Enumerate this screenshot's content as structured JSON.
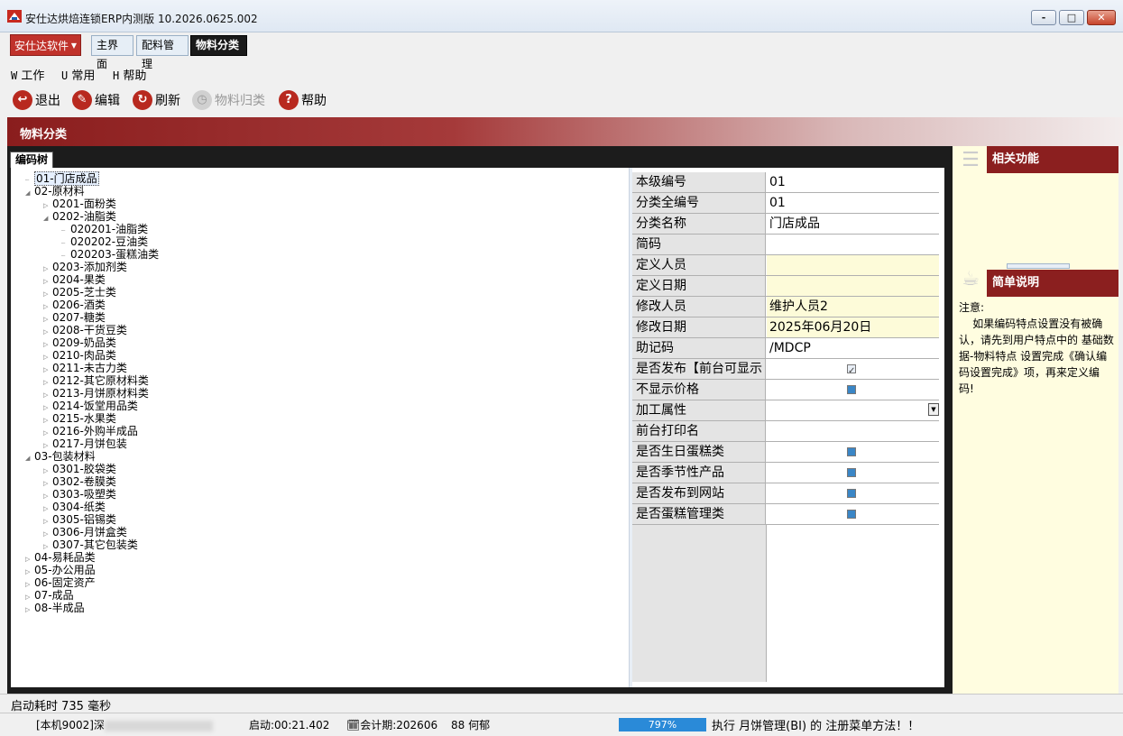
{
  "window": {
    "title": "安仕达烘焙连锁ERP内测版   10.2026.0625.002",
    "minimize": "-",
    "maximize": "□",
    "close": "✕"
  },
  "tabs": {
    "brand": "安仕达软件",
    "items": [
      "主界面",
      "配料管理",
      "物料分类"
    ]
  },
  "menu": [
    {
      "key": "W",
      "label": "工作"
    },
    {
      "key": "U",
      "label": "常用"
    },
    {
      "key": "H",
      "label": "帮助"
    }
  ],
  "toolbar": {
    "exit": "退出",
    "edit": "编辑",
    "refresh": "刷新",
    "categorize": "物料归类",
    "help": "帮助"
  },
  "page": {
    "title": "物料分类",
    "tree_tab": "编码树"
  },
  "tree": [
    {
      "label": "01-门店成品",
      "level": 0,
      "expander": "",
      "selected": true
    },
    {
      "label": "02-原材料",
      "level": 0,
      "expander": "◢"
    },
    {
      "label": "0201-面粉类",
      "level": 1,
      "expander": "▷"
    },
    {
      "label": "0202-油脂类",
      "level": 1,
      "expander": "◢"
    },
    {
      "label": "020201-油脂类",
      "level": 2,
      "expander": ""
    },
    {
      "label": "020202-豆油类",
      "level": 2,
      "expander": ""
    },
    {
      "label": "020203-蛋糕油类",
      "level": 2,
      "expander": ""
    },
    {
      "label": "0203-添加剂类",
      "level": 1,
      "expander": "▷"
    },
    {
      "label": "0204-果类",
      "level": 1,
      "expander": "▷"
    },
    {
      "label": "0205-芝士类",
      "level": 1,
      "expander": "▷"
    },
    {
      "label": "0206-酒类",
      "level": 1,
      "expander": "▷"
    },
    {
      "label": "0207-糖类",
      "level": 1,
      "expander": "▷"
    },
    {
      "label": "0208-干货豆类",
      "level": 1,
      "expander": "▷"
    },
    {
      "label": "0209-奶品类",
      "level": 1,
      "expander": "▷"
    },
    {
      "label": "0210-肉品类",
      "level": 1,
      "expander": "▷"
    },
    {
      "label": "0211-未古力类",
      "level": 1,
      "expander": "▷"
    },
    {
      "label": "0212-其它原材料类",
      "level": 1,
      "expander": "▷"
    },
    {
      "label": "0213-月饼原材料类",
      "level": 1,
      "expander": "▷"
    },
    {
      "label": "0214-饭堂用品类",
      "level": 1,
      "expander": "▷"
    },
    {
      "label": "0215-水果类",
      "level": 1,
      "expander": "▷"
    },
    {
      "label": "0216-外购半成品",
      "level": 1,
      "expander": "▷"
    },
    {
      "label": "0217-月饼包装",
      "level": 1,
      "expander": "▷"
    },
    {
      "label": "03-包装材料",
      "level": 0,
      "expander": "◢"
    },
    {
      "label": "0301-胶袋类",
      "level": 1,
      "expander": "▷"
    },
    {
      "label": "0302-卷膜类",
      "level": 1,
      "expander": "▷"
    },
    {
      "label": "0303-吸塑类",
      "level": 1,
      "expander": "▷"
    },
    {
      "label": "0304-纸类",
      "level": 1,
      "expander": "▷"
    },
    {
      "label": "0305-铝锡类",
      "level": 1,
      "expander": "▷"
    },
    {
      "label": "0306-月饼盒类",
      "level": 1,
      "expander": "▷"
    },
    {
      "label": "0307-其它包装类",
      "level": 1,
      "expander": "▷"
    },
    {
      "label": "04-易耗品类",
      "level": 0,
      "expander": "▷"
    },
    {
      "label": "05-办公用品",
      "level": 0,
      "expander": "▷"
    },
    {
      "label": "06-固定资产",
      "level": 0,
      "expander": "▷"
    },
    {
      "label": "07-成品",
      "level": 0,
      "expander": "▷"
    },
    {
      "label": "08-半成品",
      "level": 0,
      "expander": "▷"
    }
  ],
  "properties": [
    {
      "label": "本级编号",
      "value": "01",
      "kind": "text",
      "bg": "white"
    },
    {
      "label": "分类全编号",
      "value": "01",
      "kind": "text",
      "bg": "white"
    },
    {
      "label": "分类名称",
      "value": "门店成品",
      "kind": "text",
      "bg": "white"
    },
    {
      "label": "简码",
      "value": "",
      "kind": "text",
      "bg": "white"
    },
    {
      "label": "定义人员",
      "value": "",
      "kind": "text",
      "bg": "yellow"
    },
    {
      "label": "定义日期",
      "value": "",
      "kind": "text",
      "bg": "yellow"
    },
    {
      "label": "修改人员",
      "value": "维护人员2",
      "kind": "text",
      "bg": "yellow"
    },
    {
      "label": "修改日期",
      "value": "2025年06月20日",
      "kind": "text",
      "bg": "yellow"
    },
    {
      "label": "助记码",
      "value": "/MDCP",
      "kind": "text",
      "bg": "white"
    },
    {
      "label": "是否发布【前台可显示",
      "value": "",
      "kind": "check",
      "checked": true,
      "bg": "white"
    },
    {
      "label": "不显示价格",
      "value": "",
      "kind": "check",
      "checked": false,
      "bg": "white"
    },
    {
      "label": "加工属性",
      "value": "",
      "kind": "dropdown",
      "bg": "white"
    },
    {
      "label": "前台打印名",
      "value": "",
      "kind": "text",
      "bg": "white"
    },
    {
      "label": "是否生日蛋糕类",
      "value": "",
      "kind": "check",
      "checked": false,
      "bg": "white"
    },
    {
      "label": "是否季节性产品",
      "value": "",
      "kind": "check",
      "checked": false,
      "bg": "white"
    },
    {
      "label": "是否发布到网站",
      "value": "",
      "kind": "check",
      "checked": false,
      "bg": "white"
    },
    {
      "label": "是否蛋糕管理类",
      "value": "",
      "kind": "check",
      "checked": false,
      "bg": "white"
    }
  ],
  "right_panel": {
    "related_title": "相关功能",
    "note_title": "简单说明",
    "note_text": "注意:\n    如果编码特点设置没有被确认，请先到用户特点中的 基础数据-物料特点 设置完成《确认编码设置完成》项，再来定义编码!"
  },
  "status": {
    "startup": "启动耗时 735 毫秒",
    "machine": "[本机9002]深",
    "uptime": "启动:00:21.402",
    "period": "会计期:202606",
    "user": "88 何郁",
    "progress": 0.797,
    "progress_label": "797%",
    "message": "执行 月饼管理(BI) 的 注册菜单方法！！"
  }
}
